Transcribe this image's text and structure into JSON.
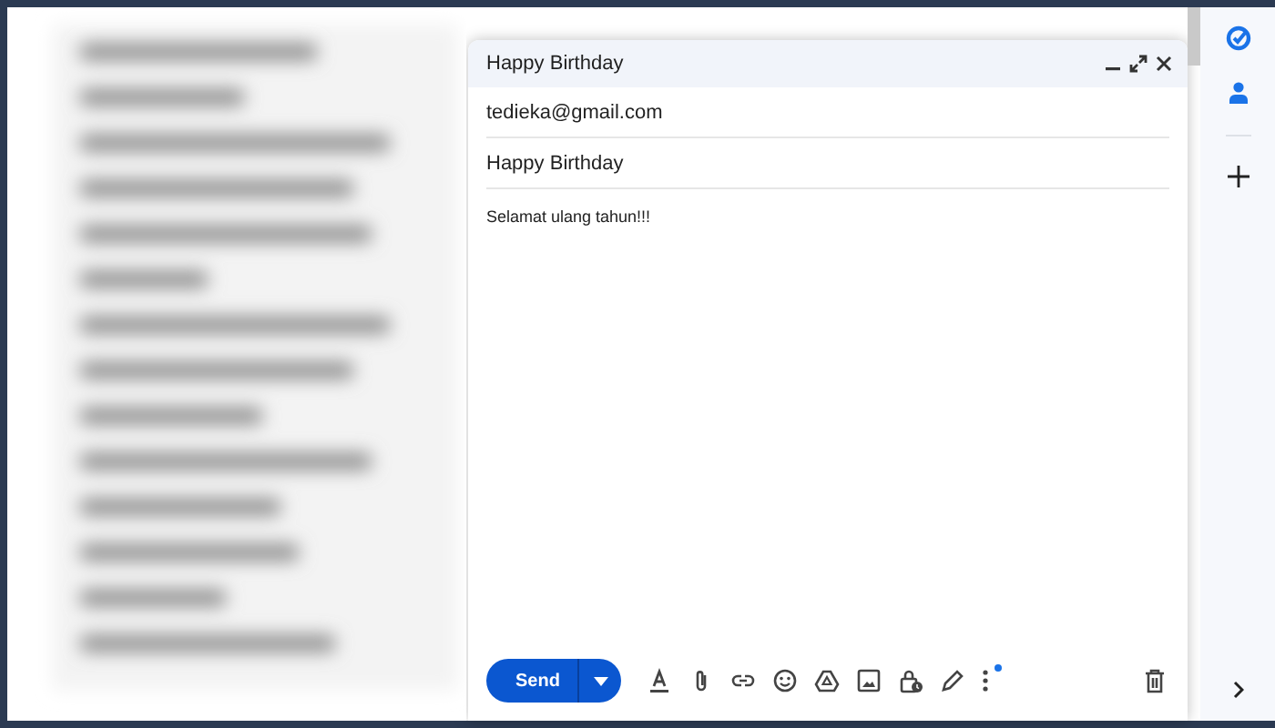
{
  "compose": {
    "title": "Happy Birthday",
    "recipient": "tedieka@gmail.com",
    "subject": "Happy Birthday",
    "body": "Selamat ulang tahun!!!",
    "send_label": "Send",
    "more_options_badge": true
  }
}
